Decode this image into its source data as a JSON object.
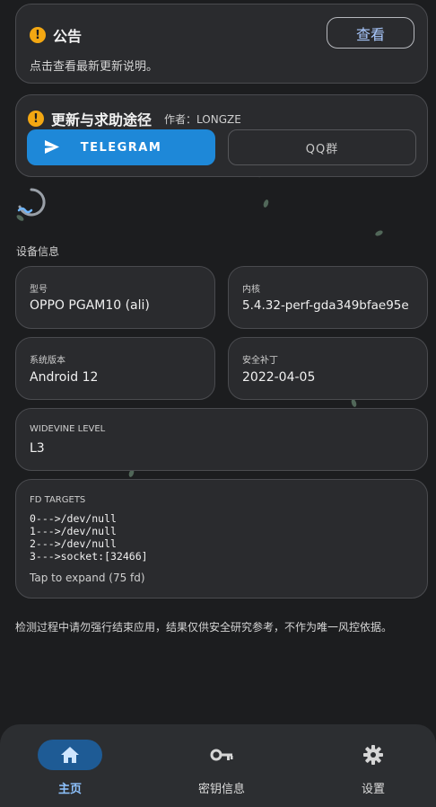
{
  "announcement": {
    "title": "公告",
    "subtitle": "点击查看最新更新说明。",
    "view_label": "查看"
  },
  "help": {
    "title": "更新与求助途径",
    "author": "作者：LONGZE",
    "telegram_label": "TELEGRAM",
    "qq_label": "QQ群"
  },
  "device": {
    "section_label": "设备信息",
    "model_label": "型号",
    "model_value": "OPPO PGAM10 (ali)",
    "kernel_label": "内核",
    "kernel_value": "5.4.32-perf-gda349bfae95e",
    "system_label": "系统版本",
    "system_value": "Android 12",
    "patch_label": "安全补丁",
    "patch_value": "2022-04-05",
    "widevine_label": "WIDEVINE LEVEL",
    "widevine_value": "L3"
  },
  "fd": {
    "label": "FD TARGETS",
    "lines": [
      "0--->/dev/null",
      "1--->/dev/null",
      "2--->/dev/null",
      "3--->socket:[32466]"
    ],
    "expand": "Tap to expand (75 fd)"
  },
  "notice": "检测过程中请勿强行结束应用，结果仅供安全研究参考，不作为唯一风控依据。",
  "nav": {
    "home": "主页",
    "keys": "密钥信息",
    "settings": "设置"
  },
  "colors": {
    "accent": "#1e88d8",
    "warning_icon": "#f3a712",
    "nav_active": "#1e5b95"
  },
  "icons": [
    "info-icon",
    "send-icon",
    "home-icon",
    "key-icon",
    "gear-icon",
    "loading-spinner"
  ]
}
